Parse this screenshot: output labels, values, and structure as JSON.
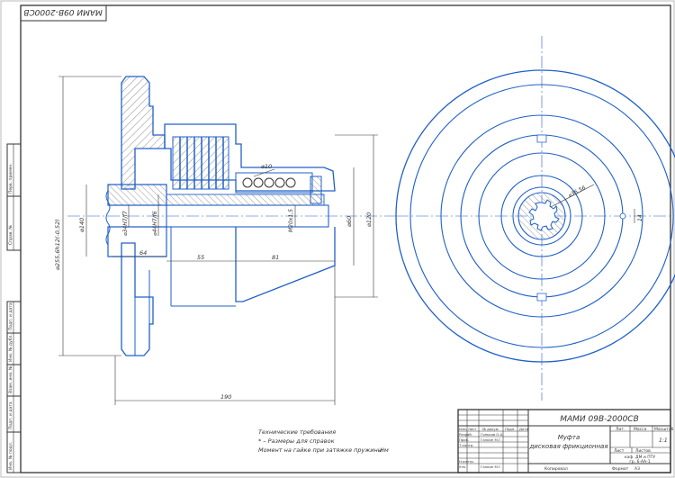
{
  "stamp_rotated": "МАМИ 09В-2000СВ",
  "dims": {
    "d_outer": "⌀255,6h12(-0,52)",
    "d140": "⌀140",
    "d34": "⌀34H7/f7",
    "d44": "⌀44H7/f6",
    "m20": "M20x1,5",
    "d60": "⌀60",
    "d120": "⌀120",
    "d10": "⌀10",
    "len64": "64",
    "len55": "55",
    "len81": "81",
    "len190": "190",
    "r_dia": "⌀36,56",
    "r_14": "14"
  },
  "notes": {
    "title": "Технические требования",
    "line1": "* – Размеры для справок",
    "line2": "Момент на гайке при затяжке пружины",
    "unit": "Нм"
  },
  "title_block": {
    "doc_code": "МАМИ 09В-2000СВ",
    "name_line1": "Муфта",
    "name_line2": "дисковая фрикционная",
    "col_lit": "Лит.",
    "col_mass": "Масса",
    "col_scale": "Масштаб",
    "scale": "1:1",
    "sheet": "Лист",
    "sheets": "Листов",
    "org_line1": "каф. ДМ и ПТУ",
    "org_line2": "гр. 6-АА-1",
    "row_izm": "Изм.",
    "row_list": "Лист",
    "row_doc": "№ докум.",
    "row_sign": "Подп.",
    "row_date": "Дата",
    "razrab": "Разраб.",
    "razrab_name": "Гоньков О.А.",
    "prov": "Пров.",
    "prov_name": "Галкин М.Г.",
    "tkontr": "Т.контр.",
    "nkontr": "Н.контр.",
    "utv": "Утв.",
    "utv_name": "Галкин М.Г.",
    "kopiroval": "Копировал",
    "format": "Формат",
    "format_val": "А3"
  },
  "margin_labels": {
    "perv_prim": "Перв. примен.",
    "sprav": "Справ. №",
    "podp_data_1": "Подп. и дата",
    "inv_dubl": "Инв. № дубл.",
    "vzam_inv": "Взам. инв. №",
    "podp_data_2": "Подп. и дата",
    "inv_podl": "Инв. № подл."
  }
}
